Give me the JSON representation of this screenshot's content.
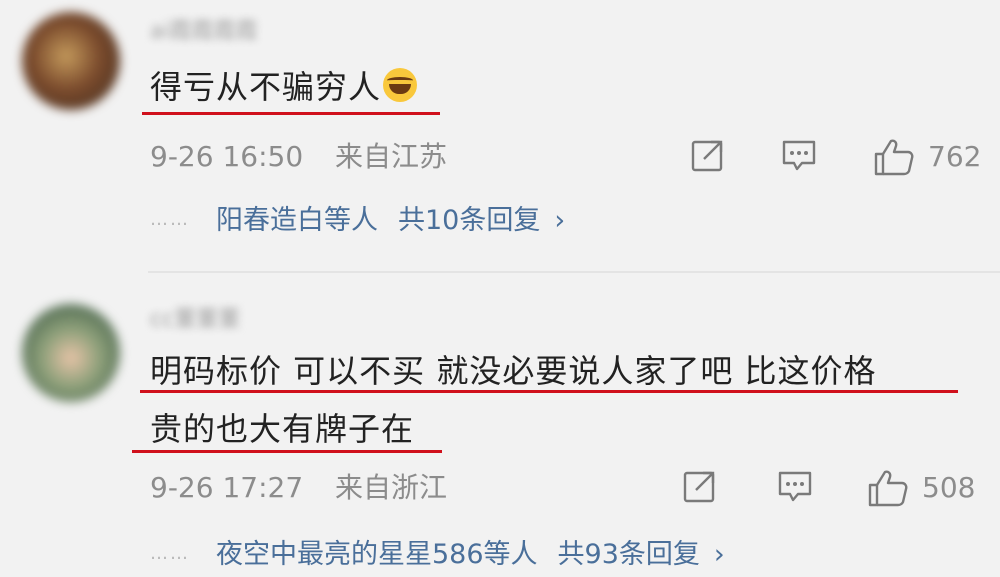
{
  "comments": [
    {
      "username": "ai霞霞霞霞",
      "text_lines": [
        "得亏从不骗穷人"
      ],
      "emoji": "laughing-tears-emoji",
      "time": "9-26 16:50",
      "location": "来自江苏",
      "likes": "762",
      "reply_names": "阳春造白等人",
      "reply_count": "共10条回复",
      "chevron": "›"
    },
    {
      "username": "cc董董董",
      "text_lines": [
        "明码标价 可以不买 就没必要说人家了吧 比这价格",
        "贵的也大有牌子在"
      ],
      "time": "9-26 17:27",
      "location": "来自浙江",
      "likes": "508",
      "reply_names": "夜空中最亮的星星586等人",
      "reply_count": "共93条回复",
      "chevron": "›"
    }
  ],
  "dots": "……",
  "colors": {
    "background": "#f2f2f2",
    "highlight_underline": "#d0101c",
    "reply_link": "#4a6f9a",
    "meta_text": "#8c8c8c"
  }
}
